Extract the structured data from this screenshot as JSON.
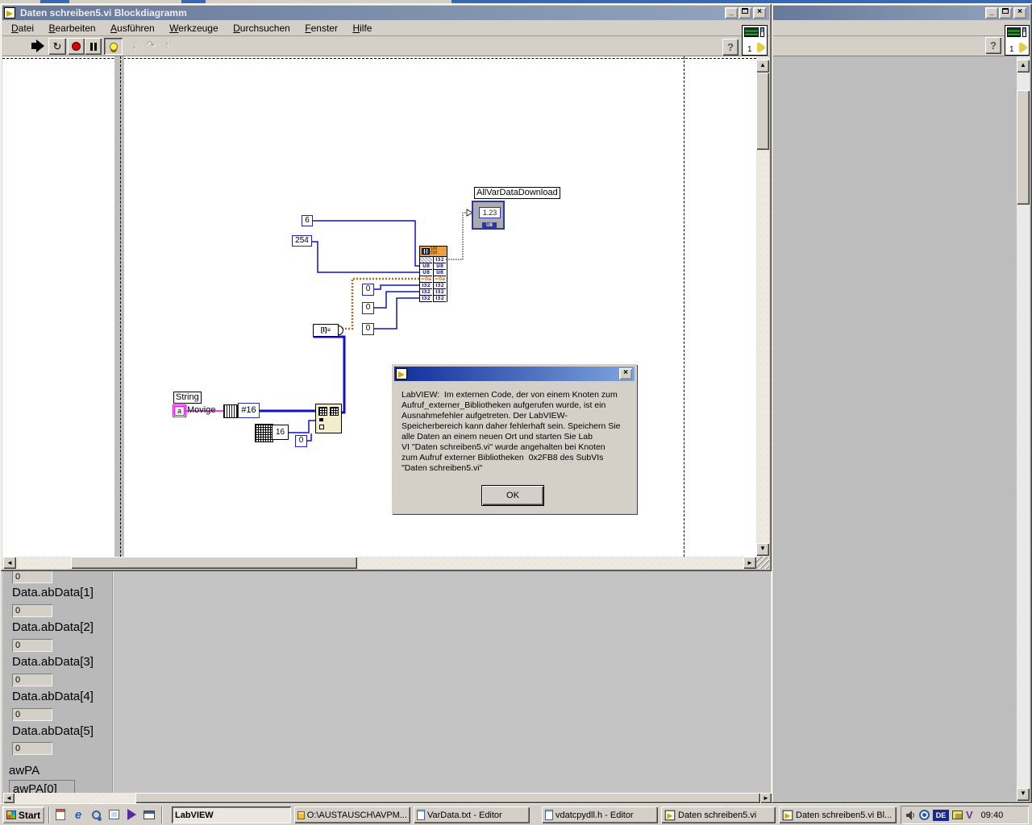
{
  "main_window": {
    "title": "Daten schreiben5.vi Blockdiagramm",
    "menu": [
      {
        "accel": "D",
        "rest": "atei"
      },
      {
        "accel": "B",
        "rest": "earbeiten"
      },
      {
        "accel": "A",
        "rest": "usführen"
      },
      {
        "accel": "W",
        "rest": "erkzeuge"
      },
      {
        "accel": "D",
        "rest": "urchsuchen"
      },
      {
        "accel": "F",
        "rest": "enster"
      },
      {
        "accel": "H",
        "rest": "ilfe"
      }
    ],
    "help_button": "?",
    "vi_icon_number": "1",
    "minimize_glyph": "_",
    "close_glyph": "×"
  },
  "diagram": {
    "constants": {
      "c6": "6",
      "c254": "254",
      "zero1": "0",
      "zero2": "0",
      "zero3": "0",
      "zero4": "0"
    },
    "init_array_size": "16",
    "count_label": "#16",
    "string_label": "String",
    "string_value": "Movige",
    "string_terminal_glyph": "a",
    "indicator_label": "AllVarDataDownload",
    "indicator_value": "1.23",
    "indicator_type": "U8",
    "node_header_bits_line1": "100",
    "node_header_bits_line2": "010",
    "node_rows": [
      [
        "",
        "I32"
      ],
      [
        "U8",
        "U8"
      ],
      [
        "U8",
        "U8"
      ],
      [
        "=0a",
        "=0a"
      ],
      [
        "I32",
        "I32"
      ],
      [
        "I32",
        "I32"
      ],
      [
        "I32",
        "I32"
      ]
    ]
  },
  "dialog": {
    "message_lines": [
      "LabVIEW:  Im externen Code, der von einem Knoten zum",
      "Aufruf_externer_Bibliotheken aufgerufen wurde, ist ein",
      "Ausnahmefehler aufgetreten. Der LabVIEW-",
      "Speicherbereich kann daher fehlerhaft sein. Speichern Sie",
      "alle Daten an einem neuen Ort und starten Sie Lab",
      "VI \"Daten schreiben5.vi\" wurde angehalten bei Knoten",
      "zum Aufruf externer Bibliotheken  0x2FB8 des SubVIs",
      "\"Daten schreiben5.vi\""
    ],
    "ok_label": "OK",
    "close_glyph": "×"
  },
  "panel_window": {
    "fields": [
      {
        "label": "",
        "value": "0"
      },
      {
        "label": "Data.abData[1]",
        "value": "0"
      },
      {
        "label": "Data.abData[2]",
        "value": "0"
      },
      {
        "label": "Data.abData[3]",
        "value": "0"
      },
      {
        "label": "Data.abData[4]",
        "value": "0"
      },
      {
        "label": "Data.abData[5]",
        "value": "0"
      }
    ],
    "awpa_label": "awPA",
    "awpa0_label": "awPA[0]"
  },
  "right_window": {
    "help_button": "?",
    "vi_icon_number": "1",
    "minimize_glyph": "_",
    "close_glyph": "×"
  },
  "taskbar": {
    "start_label": "Start",
    "buttons": [
      {
        "label": "LabVIEW"
      },
      {
        "label": "O:\\AUSTAUSCH\\AVPM..."
      },
      {
        "label": "VarData.txt - Editor"
      },
      {
        "label": "vdatcpydll.h - Editor"
      },
      {
        "label": "Daten schreiben5.vi"
      },
      {
        "label": "Daten schreiben5.vi Bl..."
      }
    ],
    "tray": {
      "keyboard_layout": "DE",
      "time": "09:40"
    }
  }
}
